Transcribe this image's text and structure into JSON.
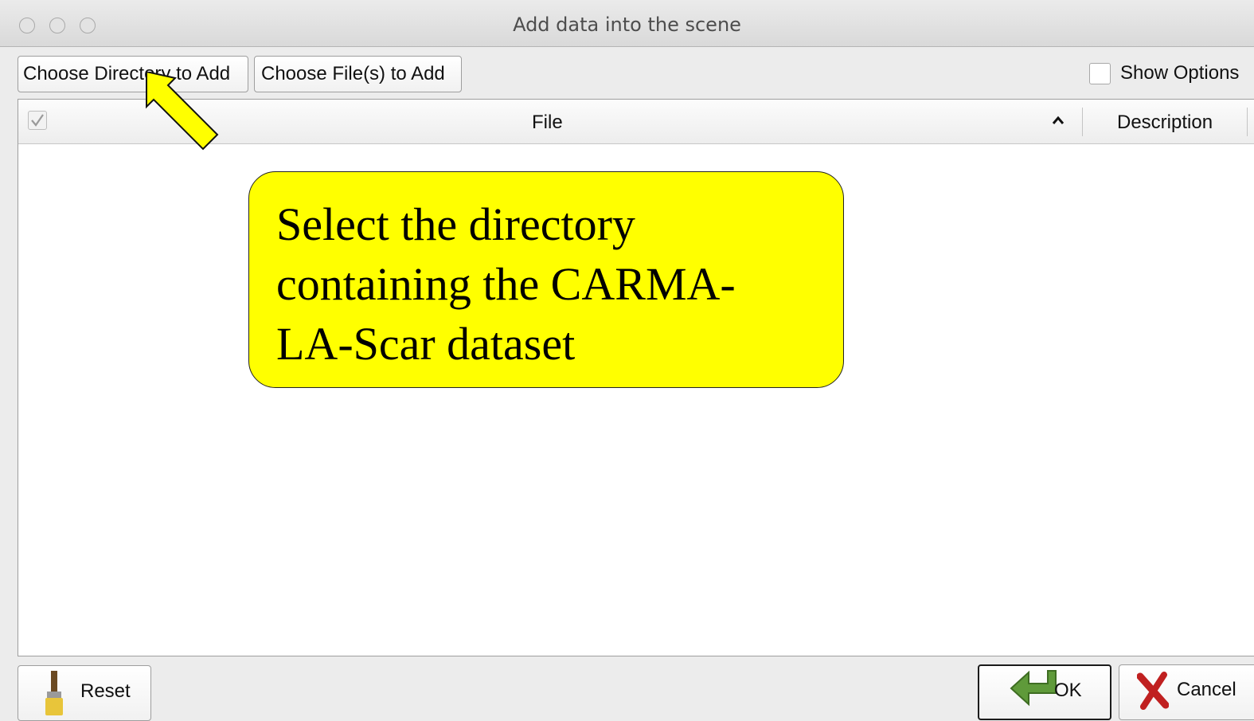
{
  "window": {
    "title": "Add data into the scene"
  },
  "toolbar": {
    "choose_directory_label": "Choose Directory to Add",
    "choose_files_label": "Choose File(s) to Add",
    "show_options_label": "Show Options",
    "show_options_checked": false
  },
  "table": {
    "columns": {
      "file": "File",
      "description": "Description"
    },
    "sort_indicator": "^",
    "rows": []
  },
  "annotation": {
    "text": "Select the directory containing the CARMA-LA-Scar dataset",
    "lines": [
      "Select the directory",
      "containing the CARMA-",
      "LA-Scar dataset"
    ],
    "color": "#ffff00"
  },
  "footer": {
    "reset_label": "Reset",
    "ok_label": "OK",
    "cancel_label": "Cancel"
  },
  "icons": {
    "reset": "paintbrush-icon",
    "ok": "green-arrow-icon",
    "cancel": "red-x-icon"
  }
}
